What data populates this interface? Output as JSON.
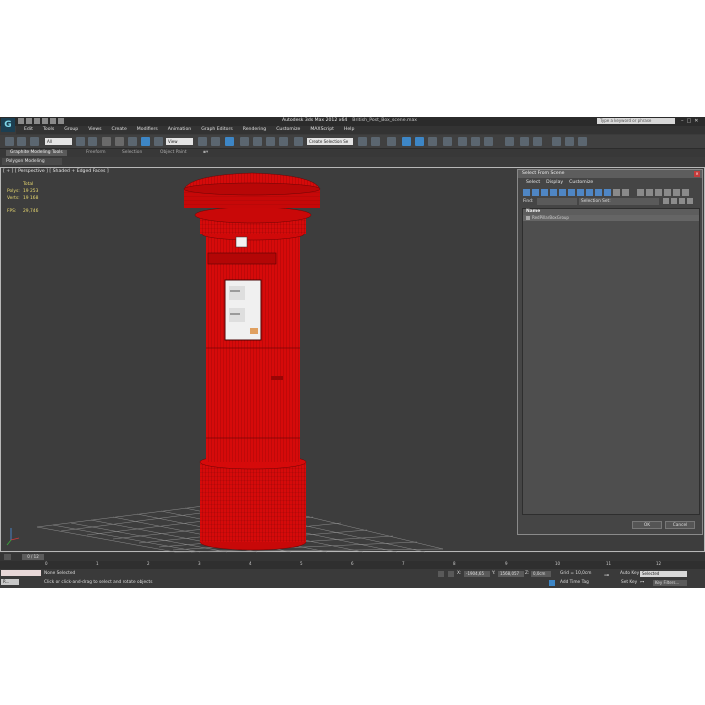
{
  "app": {
    "title": "Autodesk 3ds Max 2012 x64",
    "file_name": "British_Post_Box_scene.max",
    "help_search_placeholder": "Type a keyword or phrase",
    "window_buttons": [
      "–",
      "□",
      "✕"
    ]
  },
  "menu": [
    "Edit",
    "Tools",
    "Group",
    "Views",
    "Create",
    "Modifiers",
    "Animation",
    "Graph Editors",
    "Rendering",
    "Customize",
    "MAXScript",
    "Help"
  ],
  "toolbar": {
    "selection_filter": "All",
    "reference_coord": "View",
    "named_selection": "Create Selection Se"
  },
  "ribbon": {
    "tabs": [
      "Graphite Modeling Tools",
      "Freeform",
      "Selection",
      "Object Paint"
    ],
    "active_tab": "Graphite Modeling Tools",
    "panel": "Polygon Modeling"
  },
  "viewport": {
    "label": "[ + ] [ Perspective ] [ Shaded + Edged Faces ]",
    "stats": {
      "total_label": "Total",
      "polys_label": "Polys:",
      "polys_value": "19 253",
      "verts_label": "Verts:",
      "verts_value": "19 168",
      "fps_label": "FPS:",
      "fps_value": "29,746"
    },
    "model_color": "#d10a0a"
  },
  "select_dialog": {
    "title": "Select From Scene",
    "menu": [
      "Select",
      "Display",
      "Customize"
    ],
    "find_label": "Find:",
    "selection_set_label": "Selection Set:",
    "list_header": "Name",
    "items": [
      "RedPillarBoxGroup"
    ],
    "ok_label": "OK",
    "cancel_label": "Cancel"
  },
  "timeline": {
    "slider_label": "0 / 12",
    "ticks": [
      "0",
      "1",
      "2",
      "3",
      "4",
      "5",
      "6",
      "7",
      "8",
      "9",
      "10",
      "11",
      "12"
    ]
  },
  "status": {
    "selection": "None Selected",
    "prompt": "Click or click-and-drag to select and rotate objects",
    "max_label": "R...",
    "x_label": "X:",
    "x_value": "-1904,65",
    "y_label": "Y:",
    "y_value": "1568,057",
    "z_label": "Z:",
    "z_value": "0,0cm",
    "grid": "Grid = 10,0cm",
    "add_time_tag": "Add Time Tag",
    "auto_key": "Auto Key",
    "auto_key_value": "Selected",
    "set_key": "Set Key",
    "key_filters": "Key Filters..."
  }
}
